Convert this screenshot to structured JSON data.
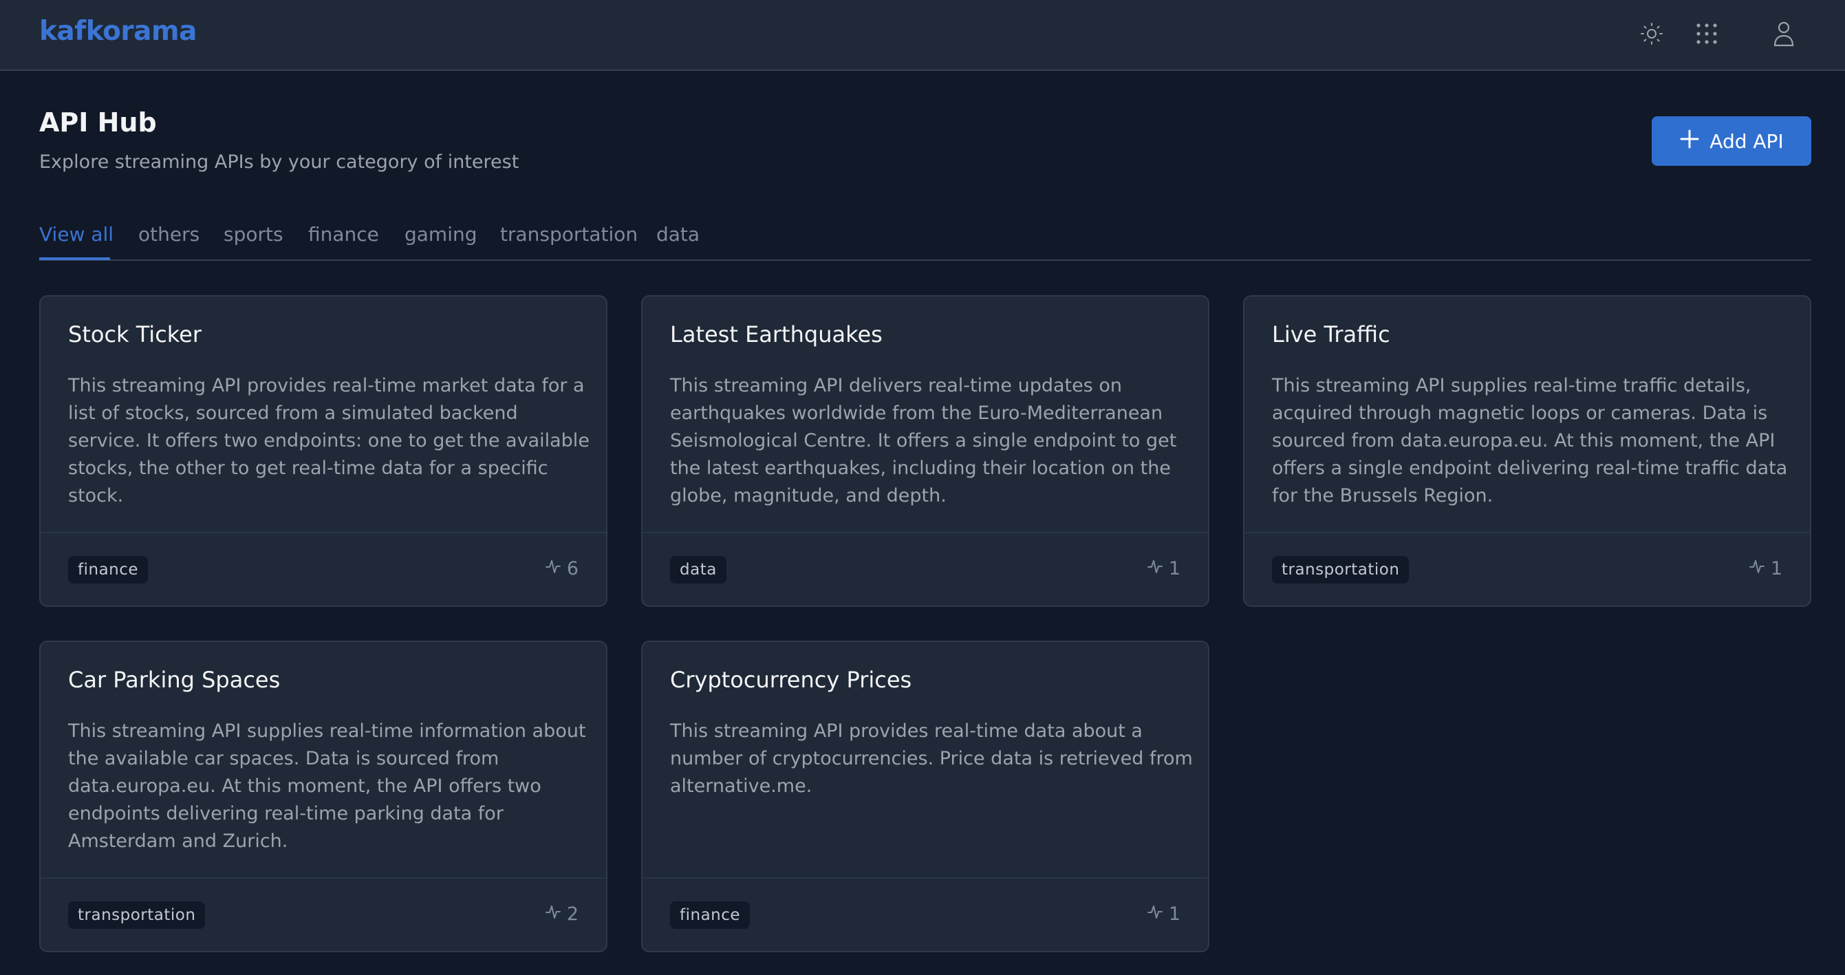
{
  "app": {
    "logo": "kafkorama"
  },
  "header_icons": {
    "theme": "sun-icon",
    "apps": "grid-icon",
    "user": "user-icon"
  },
  "page": {
    "title": "API Hub",
    "subtitle": "Explore streaming APIs by your category of interest",
    "add_button_label": "Add API"
  },
  "tabs": [
    {
      "label": "View all",
      "active": true
    },
    {
      "label": "others",
      "active": false
    },
    {
      "label": "sports",
      "active": false
    },
    {
      "label": "finance",
      "active": false
    },
    {
      "label": "gaming",
      "active": false
    },
    {
      "label": "transportation",
      "active": false
    },
    {
      "label": "data",
      "active": false
    }
  ],
  "cards": [
    {
      "title": "Stock Ticker",
      "description": "This streaming API provides real-time market data for a list of stocks, sourced from a simulated backend service. It offers two endpoints: one to get the available stocks, the other to get real-time data for a specific stock.",
      "tag": "finance",
      "count": "6"
    },
    {
      "title": "Latest Earthquakes",
      "description": "This streaming API delivers real-time updates on earthquakes worldwide from the Euro-Mediterranean Seismological Centre. It offers a single endpoint to get the latest earthquakes, including their location on the globe, magnitude, and depth.",
      "tag": "data",
      "count": "1"
    },
    {
      "title": "Live Traffic",
      "description": "This streaming API supplies real-time traffic details, acquired through magnetic loops or cameras. Data is sourced from data.europa.eu. At this moment, the API offers a single endpoint delivering real-time traffic data for the Brussels Region.",
      "tag": "transportation",
      "count": "1"
    },
    {
      "title": "Car Parking Spaces",
      "description": "This streaming API supplies real-time information about the available car spaces. Data is sourced from data.europa.eu. At this moment, the API offers two endpoints delivering real-time parking data for Amsterdam and Zurich.",
      "tag": "transportation",
      "count": "2"
    },
    {
      "title": "Cryptocurrency Prices",
      "description": "This streaming API provides real-time data about a number of cryptocurrencies. Price data is retrieved from alternative.me.",
      "tag": "finance",
      "count": "1"
    }
  ],
  "colors": {
    "background": "#111827",
    "surface": "#1f2937",
    "accent": "#3b74d4",
    "button": "#2f6fd0"
  }
}
